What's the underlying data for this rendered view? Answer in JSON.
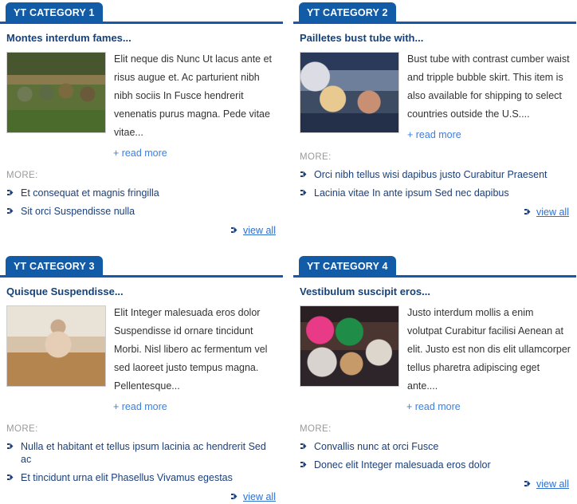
{
  "modules": [
    {
      "tab_label": "YT CATEGORY 1",
      "article": {
        "title": "Montes interdum fames...",
        "text": "Elit neque dis Nunc Ut lacus ante et risus augue et. Ac parturient nibh nibh sociis In Fusce hendrerit venenatis purus magna. Pede vitae vitae...",
        "read_more": "+ read more",
        "image_alt": "group-in-traditional-costume-photo"
      },
      "more_label": "MORE:",
      "more_items": [
        "Et consequat et magnis fringilla",
        "Sit orci Suspendisse nulla"
      ],
      "view_all": "view all"
    },
    {
      "tab_label": "YT CATEGORY 2",
      "article": {
        "title": "Pailletes bust tube with...",
        "text": "Bust tube with contrast cumber waist and tripple bubble skirt. This item is also available for shipping to select countries outside the U.S....",
        "read_more": "+ read more",
        "image_alt": "woman-with-children-photo"
      },
      "more_label": "MORE:",
      "more_items": [
        "Orci nibh tellus wisi dapibus justo Curabitur Praesent",
        "Lacinia vitae In ante ipsum Sed nec dapibus"
      ],
      "view_all": "view all"
    },
    {
      "tab_label": "YT CATEGORY 3",
      "article": {
        "title": "Quisque Suspendisse...",
        "text": "Elit Integer malesuada eros dolor Suspendisse id ornare tincidunt Morbi. Nisl libero ac fermentum vel sed laoreet justo tempus magna. Pellentesque...",
        "read_more": "+ read more",
        "image_alt": "woman-meditating-in-living-room-photo"
      },
      "more_label": "MORE:",
      "more_items": [
        "Nulla et habitant et tellus ipsum lacinia ac hendrerit Sed ac",
        "Et tincidunt urna elit Phasellus Vivamus egestas"
      ],
      "view_all": "view all"
    },
    {
      "tab_label": "YT CATEGORY 4",
      "article": {
        "title": "Vestibulum suscipit eros...",
        "text": "Justo interdum mollis a enim volutpat Curabitur facilisi Aenean at elit. Justo est non dis elit ullamcorper tellus pharetra adipiscing eget ante....",
        "read_more": "+ read more",
        "image_alt": "carnival-dancers-photo"
      },
      "more_label": "MORE:",
      "more_items": [
        "Convallis nunc at orci Fusce",
        "Donec elit Integer malesuada eros dolor"
      ],
      "view_all": "view all"
    }
  ],
  "colors": {
    "tab_background": "#125ba6",
    "tab_text": "#ffffff",
    "rule": "#1559a8",
    "title": "#15427a",
    "body_text": "#333333",
    "read_more_link": "#3b7fe0",
    "more_label": "#9a9a9a",
    "list_link": "#1b3f7a",
    "view_all_link": "#2f6fd0",
    "bullet": "#1b3f7a"
  },
  "icons": {
    "bullet": "arrow-bullet-icon"
  }
}
